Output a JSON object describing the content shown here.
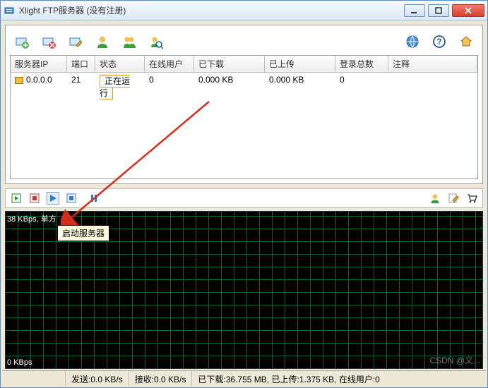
{
  "window": {
    "title": "Xlight FTP服务器 (没有注册)"
  },
  "table": {
    "headers": {
      "ip": "服务器IP",
      "port": "端口",
      "status": "状态",
      "users": "在线用户",
      "down": "已下载",
      "up": "已上传",
      "log": "登录总数",
      "note": "注释"
    },
    "row": {
      "ip": "0.0.0.0",
      "port": "21",
      "status": "正在运行",
      "users": "0",
      "down": "0.000 KB",
      "up": "0.000 KB",
      "log": "0",
      "note": ""
    }
  },
  "tooltip": "启动服务器",
  "graph": {
    "top": "38 KBps, 单方",
    "bottom": "0 KBps"
  },
  "status": {
    "send": "发送:0.0 KB/s",
    "recv": "接收:0.0 KB/s",
    "totals": "已下载:36.755 MB, 已上传:1.375 KB, 在线用户:0"
  },
  "watermark": "CSDN @义..."
}
